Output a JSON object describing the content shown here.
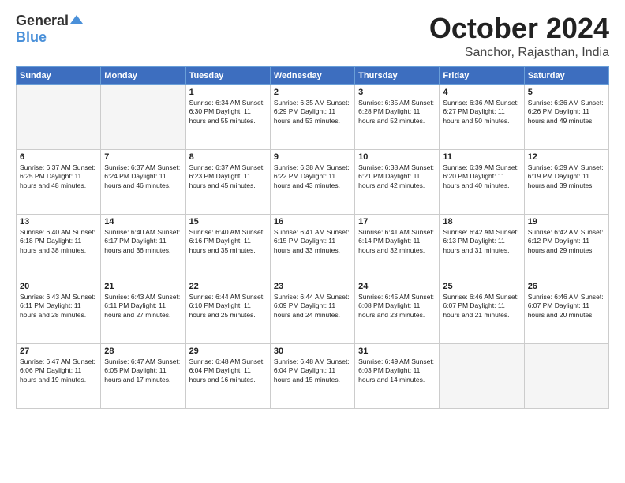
{
  "header": {
    "logo_general": "General",
    "logo_blue": "Blue",
    "month": "October 2024",
    "location": "Sanchor, Rajasthan, India"
  },
  "days_of_week": [
    "Sunday",
    "Monday",
    "Tuesday",
    "Wednesday",
    "Thursday",
    "Friday",
    "Saturday"
  ],
  "weeks": [
    [
      {
        "day": "",
        "content": ""
      },
      {
        "day": "",
        "content": ""
      },
      {
        "day": "1",
        "content": "Sunrise: 6:34 AM\nSunset: 6:30 PM\nDaylight: 11 hours and 55 minutes."
      },
      {
        "day": "2",
        "content": "Sunrise: 6:35 AM\nSunset: 6:29 PM\nDaylight: 11 hours and 53 minutes."
      },
      {
        "day": "3",
        "content": "Sunrise: 6:35 AM\nSunset: 6:28 PM\nDaylight: 11 hours and 52 minutes."
      },
      {
        "day": "4",
        "content": "Sunrise: 6:36 AM\nSunset: 6:27 PM\nDaylight: 11 hours and 50 minutes."
      },
      {
        "day": "5",
        "content": "Sunrise: 6:36 AM\nSunset: 6:26 PM\nDaylight: 11 hours and 49 minutes."
      }
    ],
    [
      {
        "day": "6",
        "content": "Sunrise: 6:37 AM\nSunset: 6:25 PM\nDaylight: 11 hours and 48 minutes."
      },
      {
        "day": "7",
        "content": "Sunrise: 6:37 AM\nSunset: 6:24 PM\nDaylight: 11 hours and 46 minutes."
      },
      {
        "day": "8",
        "content": "Sunrise: 6:37 AM\nSunset: 6:23 PM\nDaylight: 11 hours and 45 minutes."
      },
      {
        "day": "9",
        "content": "Sunrise: 6:38 AM\nSunset: 6:22 PM\nDaylight: 11 hours and 43 minutes."
      },
      {
        "day": "10",
        "content": "Sunrise: 6:38 AM\nSunset: 6:21 PM\nDaylight: 11 hours and 42 minutes."
      },
      {
        "day": "11",
        "content": "Sunrise: 6:39 AM\nSunset: 6:20 PM\nDaylight: 11 hours and 40 minutes."
      },
      {
        "day": "12",
        "content": "Sunrise: 6:39 AM\nSunset: 6:19 PM\nDaylight: 11 hours and 39 minutes."
      }
    ],
    [
      {
        "day": "13",
        "content": "Sunrise: 6:40 AM\nSunset: 6:18 PM\nDaylight: 11 hours and 38 minutes."
      },
      {
        "day": "14",
        "content": "Sunrise: 6:40 AM\nSunset: 6:17 PM\nDaylight: 11 hours and 36 minutes."
      },
      {
        "day": "15",
        "content": "Sunrise: 6:40 AM\nSunset: 6:16 PM\nDaylight: 11 hours and 35 minutes."
      },
      {
        "day": "16",
        "content": "Sunrise: 6:41 AM\nSunset: 6:15 PM\nDaylight: 11 hours and 33 minutes."
      },
      {
        "day": "17",
        "content": "Sunrise: 6:41 AM\nSunset: 6:14 PM\nDaylight: 11 hours and 32 minutes."
      },
      {
        "day": "18",
        "content": "Sunrise: 6:42 AM\nSunset: 6:13 PM\nDaylight: 11 hours and 31 minutes."
      },
      {
        "day": "19",
        "content": "Sunrise: 6:42 AM\nSunset: 6:12 PM\nDaylight: 11 hours and 29 minutes."
      }
    ],
    [
      {
        "day": "20",
        "content": "Sunrise: 6:43 AM\nSunset: 6:11 PM\nDaylight: 11 hours and 28 minutes."
      },
      {
        "day": "21",
        "content": "Sunrise: 6:43 AM\nSunset: 6:11 PM\nDaylight: 11 hours and 27 minutes."
      },
      {
        "day": "22",
        "content": "Sunrise: 6:44 AM\nSunset: 6:10 PM\nDaylight: 11 hours and 25 minutes."
      },
      {
        "day": "23",
        "content": "Sunrise: 6:44 AM\nSunset: 6:09 PM\nDaylight: 11 hours and 24 minutes."
      },
      {
        "day": "24",
        "content": "Sunrise: 6:45 AM\nSunset: 6:08 PM\nDaylight: 11 hours and 23 minutes."
      },
      {
        "day": "25",
        "content": "Sunrise: 6:46 AM\nSunset: 6:07 PM\nDaylight: 11 hours and 21 minutes."
      },
      {
        "day": "26",
        "content": "Sunrise: 6:46 AM\nSunset: 6:07 PM\nDaylight: 11 hours and 20 minutes."
      }
    ],
    [
      {
        "day": "27",
        "content": "Sunrise: 6:47 AM\nSunset: 6:06 PM\nDaylight: 11 hours and 19 minutes."
      },
      {
        "day": "28",
        "content": "Sunrise: 6:47 AM\nSunset: 6:05 PM\nDaylight: 11 hours and 17 minutes."
      },
      {
        "day": "29",
        "content": "Sunrise: 6:48 AM\nSunset: 6:04 PM\nDaylight: 11 hours and 16 minutes."
      },
      {
        "day": "30",
        "content": "Sunrise: 6:48 AM\nSunset: 6:04 PM\nDaylight: 11 hours and 15 minutes."
      },
      {
        "day": "31",
        "content": "Sunrise: 6:49 AM\nSunset: 6:03 PM\nDaylight: 11 hours and 14 minutes."
      },
      {
        "day": "",
        "content": ""
      },
      {
        "day": "",
        "content": ""
      }
    ]
  ]
}
